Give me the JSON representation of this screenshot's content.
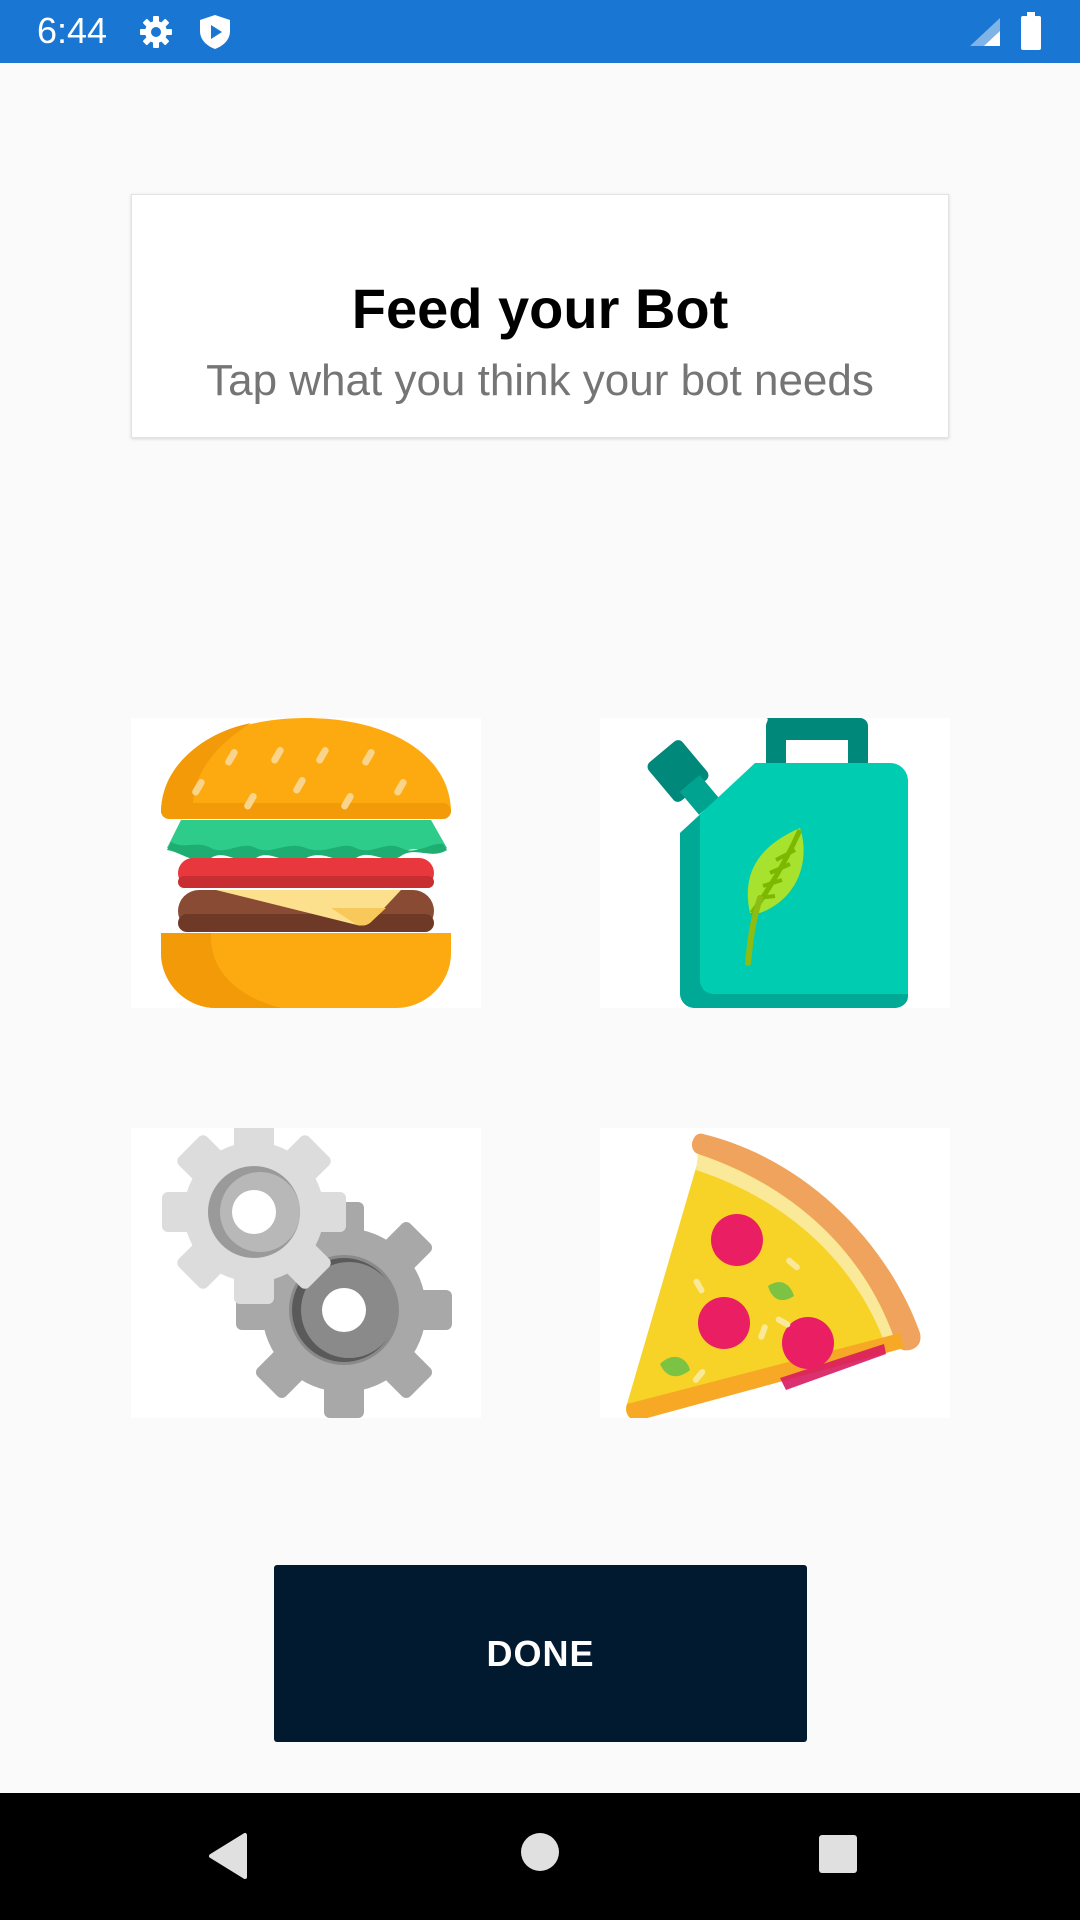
{
  "status_bar": {
    "time": "6:44",
    "icons": [
      "settings-gear-icon",
      "shield-play-icon",
      "signal-icon",
      "battery-icon"
    ],
    "background": "#1976d2"
  },
  "card": {
    "title": "Feed your Bot",
    "subtitle": "Tap what you think your bot needs"
  },
  "options": [
    {
      "icon": "burger-icon"
    },
    {
      "icon": "bio-fuel-canister-icon"
    },
    {
      "icon": "gears-icon"
    },
    {
      "icon": "pizza-slice-icon"
    }
  ],
  "done_button": {
    "label": "DONE",
    "background": "#021a2f"
  },
  "nav_bar": {
    "icons": [
      "back-icon",
      "home-icon",
      "recents-icon"
    ]
  }
}
